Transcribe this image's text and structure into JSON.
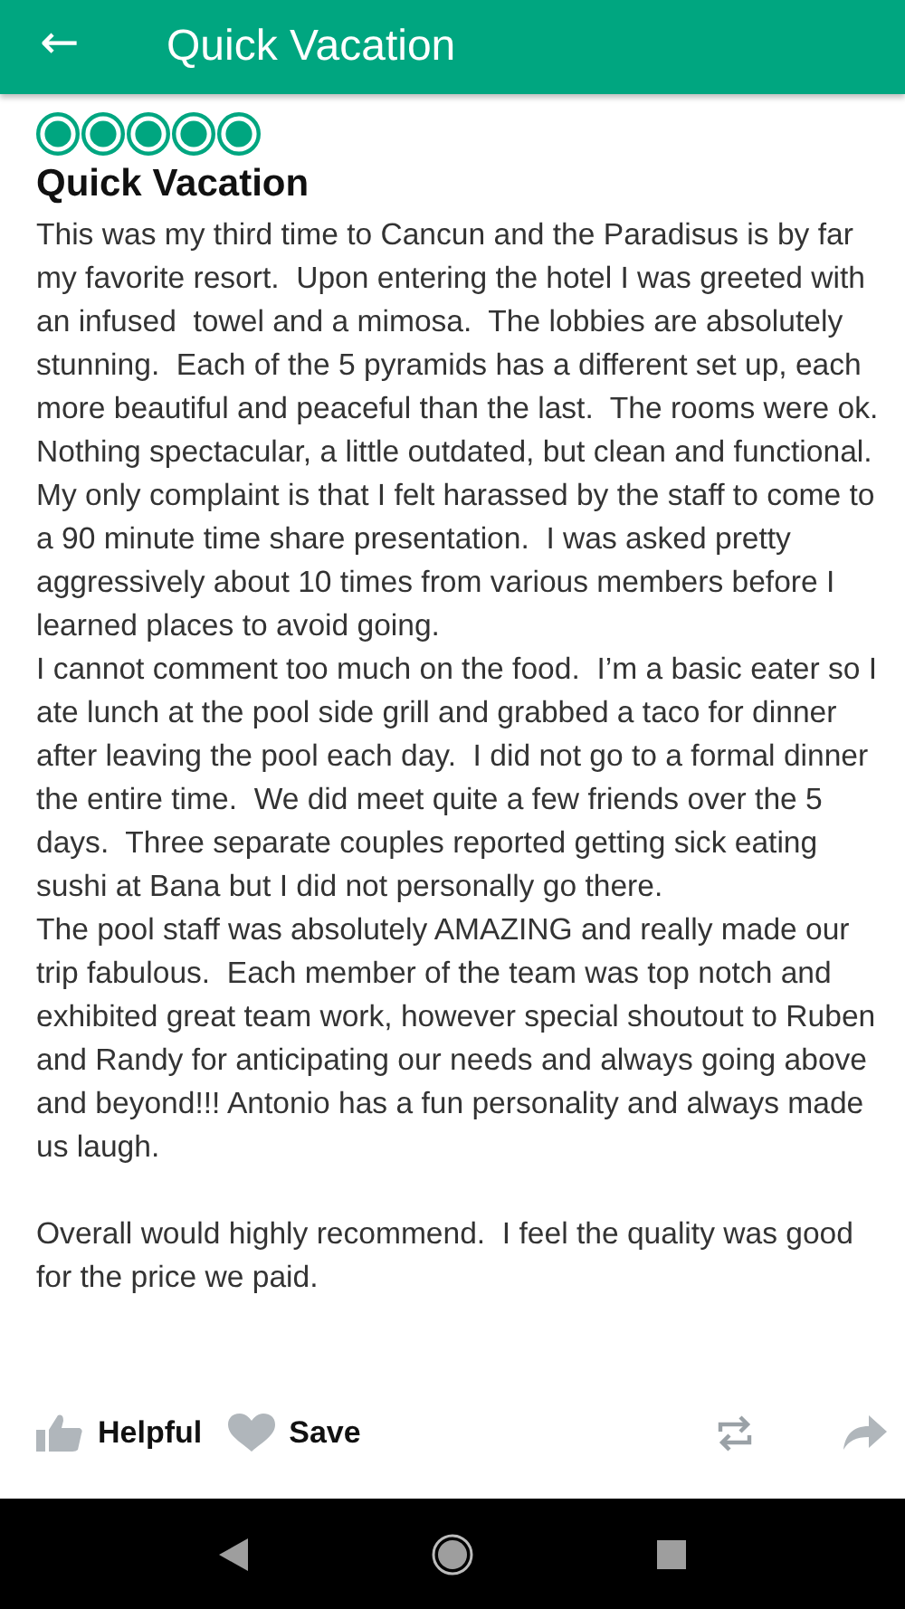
{
  "app_bar": {
    "back": "←",
    "title": "Quick Vacation"
  },
  "review": {
    "stars": 5,
    "title": "Quick Vacation",
    "body": "This was my third time to Cancun and the Paradisus is by far my favorite resort.  Upon entering the hotel I was greeted with an infused  towel and a mimosa.  The lobbies are absolutely stunning.  Each of the 5 pyramids has a different set up, each more beautiful and peaceful than the last.  The rooms were ok.  Nothing spectacular, a little outdated, but clean and functional.  My only complaint is that I felt harassed by the staff to come to a 90 minute time share presentation.  I was asked pretty aggressively about 10 times from various members before I learned places to avoid going.\nI cannot comment too much on the food.  I’m a basic eater so I ate lunch at the pool side grill and grabbed a taco for dinner after leaving the pool each day.  I did not go to a formal dinner the entire time.  We did meet quite a few friends over the 5 days.  Three separate couples reported getting sick eating sushi at Bana but I did not personally go there.\nThe pool staff was absolutely AMAZING and really made our trip fabulous.  Each member of the team was top notch and exhibited great team work, however special shoutout to Ruben and Randy for anticipating our needs and always going above and beyond!!! Antonio has a fun personality and always made us laugh.\n\nOverall would highly recommend.  I feel the quality was good for the price we paid."
  },
  "actions": [
    {
      "kind": "helpful",
      "label": "Helpful"
    },
    {
      "kind": "save",
      "label": "Save"
    },
    {
      "kind": "repost"
    },
    {
      "kind": "share"
    }
  ]
}
